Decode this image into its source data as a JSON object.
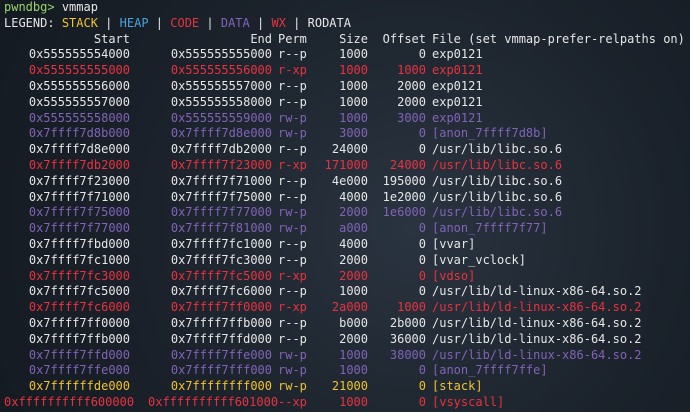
{
  "colors": {
    "stack": "#f1c232",
    "heap": "#4aa3df",
    "code": "#e8333f",
    "data": "#8064b8",
    "wx": "#e8333f",
    "rodata": "#e6e6e6",
    "prompt": "#9ad26a"
  },
  "prompt": {
    "text": "pwndbg>",
    "command": "vmmap"
  },
  "legend": {
    "label": "LEGEND:",
    "stack": "STACK",
    "heap": "HEAP",
    "code": "CODE",
    "data": "DATA",
    "wx": "WX",
    "rodata": "RODATA",
    "separator": "|"
  },
  "header": {
    "start": "Start",
    "end": "End",
    "perm": "Perm",
    "size": "Size",
    "offset": "Offset",
    "file": "File (set vmmap-prefer-relpaths on)"
  },
  "rows": [
    {
      "start": "0x555555554000",
      "end": "0x555555555000",
      "perm": "r--p",
      "size": "1000",
      "offset": "0",
      "file": "exp0121",
      "kind": "rodata"
    },
    {
      "start": "0x555555555000",
      "end": "0x555555556000",
      "perm": "r-xp",
      "size": "1000",
      "offset": "1000",
      "file": "exp0121",
      "kind": "code"
    },
    {
      "start": "0x555555556000",
      "end": "0x555555557000",
      "perm": "r--p",
      "size": "1000",
      "offset": "2000",
      "file": "exp0121",
      "kind": "rodata"
    },
    {
      "start": "0x555555557000",
      "end": "0x555555558000",
      "perm": "r--p",
      "size": "1000",
      "offset": "2000",
      "file": "exp0121",
      "kind": "rodata"
    },
    {
      "start": "0x555555558000",
      "end": "0x555555559000",
      "perm": "rw-p",
      "size": "1000",
      "offset": "3000",
      "file": "exp0121",
      "kind": "data"
    },
    {
      "start": "0x7ffff7d8b000",
      "end": "0x7ffff7d8e000",
      "perm": "rw-p",
      "size": "3000",
      "offset": "0",
      "file": "[anon_7ffff7d8b]",
      "kind": "data"
    },
    {
      "start": "0x7ffff7d8e000",
      "end": "0x7ffff7db2000",
      "perm": "r--p",
      "size": "24000",
      "offset": "0",
      "file": "/usr/lib/libc.so.6",
      "kind": "rodata"
    },
    {
      "start": "0x7ffff7db2000",
      "end": "0x7ffff7f23000",
      "perm": "r-xp",
      "size": "171000",
      "offset": "24000",
      "file": "/usr/lib/libc.so.6",
      "kind": "code"
    },
    {
      "start": "0x7ffff7f23000",
      "end": "0x7ffff7f71000",
      "perm": "r--p",
      "size": "4e000",
      "offset": "195000",
      "file": "/usr/lib/libc.so.6",
      "kind": "rodata"
    },
    {
      "start": "0x7ffff7f71000",
      "end": "0x7ffff7f75000",
      "perm": "r--p",
      "size": "4000",
      "offset": "1e2000",
      "file": "/usr/lib/libc.so.6",
      "kind": "rodata"
    },
    {
      "start": "0x7ffff7f75000",
      "end": "0x7ffff7f77000",
      "perm": "rw-p",
      "size": "2000",
      "offset": "1e6000",
      "file": "/usr/lib/libc.so.6",
      "kind": "data"
    },
    {
      "start": "0x7ffff7f77000",
      "end": "0x7ffff7f81000",
      "perm": "rw-p",
      "size": "a000",
      "offset": "0",
      "file": "[anon_7ffff7f77]",
      "kind": "data"
    },
    {
      "start": "0x7ffff7fbd000",
      "end": "0x7ffff7fc1000",
      "perm": "r--p",
      "size": "4000",
      "offset": "0",
      "file": "[vvar]",
      "kind": "rodata"
    },
    {
      "start": "0x7ffff7fc1000",
      "end": "0x7ffff7fc3000",
      "perm": "r--p",
      "size": "2000",
      "offset": "0",
      "file": "[vvar_vclock]",
      "kind": "rodata"
    },
    {
      "start": "0x7ffff7fc3000",
      "end": "0x7ffff7fc5000",
      "perm": "r-xp",
      "size": "2000",
      "offset": "0",
      "file": "[vdso]",
      "kind": "code"
    },
    {
      "start": "0x7ffff7fc5000",
      "end": "0x7ffff7fc6000",
      "perm": "r--p",
      "size": "1000",
      "offset": "0",
      "file": "/usr/lib/ld-linux-x86-64.so.2",
      "kind": "rodata"
    },
    {
      "start": "0x7ffff7fc6000",
      "end": "0x7ffff7ff0000",
      "perm": "r-xp",
      "size": "2a000",
      "offset": "1000",
      "file": "/usr/lib/ld-linux-x86-64.so.2",
      "kind": "code"
    },
    {
      "start": "0x7ffff7ff0000",
      "end": "0x7ffff7ffb000",
      "perm": "r--p",
      "size": "b000",
      "offset": "2b000",
      "file": "/usr/lib/ld-linux-x86-64.so.2",
      "kind": "rodata"
    },
    {
      "start": "0x7ffff7ffb000",
      "end": "0x7ffff7ffd000",
      "perm": "r--p",
      "size": "2000",
      "offset": "36000",
      "file": "/usr/lib/ld-linux-x86-64.so.2",
      "kind": "rodata"
    },
    {
      "start": "0x7ffff7ffd000",
      "end": "0x7ffff7ffe000",
      "perm": "rw-p",
      "size": "1000",
      "offset": "38000",
      "file": "/usr/lib/ld-linux-x86-64.so.2",
      "kind": "data"
    },
    {
      "start": "0x7ffff7ffe000",
      "end": "0x7ffff7fff000",
      "perm": "rw-p",
      "size": "1000",
      "offset": "0",
      "file": "[anon_7ffff7ffe]",
      "kind": "data"
    },
    {
      "start": "0x7ffffffde000",
      "end": "0x7ffffffff000",
      "perm": "rw-p",
      "size": "21000",
      "offset": "0",
      "file": "[stack]",
      "kind": "stack"
    },
    {
      "start": "0xffffffffff600000",
      "end": "0xffffffffff601000",
      "perm": "--xp",
      "size": "1000",
      "offset": "0",
      "file": "[vsyscall]",
      "kind": "code"
    }
  ]
}
